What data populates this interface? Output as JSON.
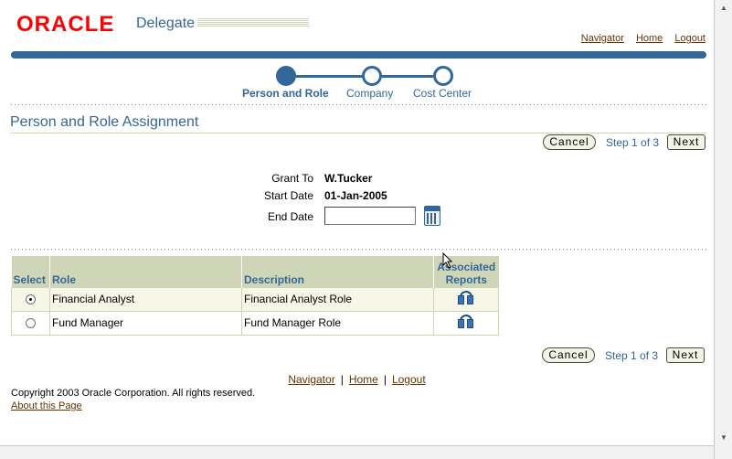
{
  "header": {
    "brand": "ORACLE",
    "app_name": "Delegate",
    "global_links": [
      "Navigator",
      "Home",
      "Logout"
    ]
  },
  "train": {
    "steps": [
      {
        "label": "Person and Role",
        "active": true
      },
      {
        "label": "Company",
        "active": false
      },
      {
        "label": "Cost Center",
        "active": false
      }
    ]
  },
  "page_title": "Person and Role Assignment",
  "nav": {
    "cancel_label": "Cancel",
    "step_text": "Step 1 of 3",
    "next_label": "Next"
  },
  "form": {
    "grant_to_label": "Grant To",
    "grant_to_value": "W.Tucker",
    "start_date_label": "Start Date",
    "start_date_value": "01-Jan-2005",
    "end_date_label": "End Date",
    "end_date_value": ""
  },
  "table": {
    "headers": {
      "select": "Select",
      "role": "Role",
      "description": "Description",
      "reports": "Associated Reports"
    },
    "rows": [
      {
        "role": "Financial Analyst",
        "description": "Financial Analyst Role",
        "selected": true
      },
      {
        "role": "Fund Manager",
        "description": "Fund Manager Role",
        "selected": false
      }
    ]
  },
  "footer": {
    "links": [
      "Navigator",
      "Home",
      "Logout"
    ],
    "separator": "|",
    "copyright": "Copyright 2003 Oracle Corporation. All rights reserved.",
    "about": "About this Page"
  },
  "colors": {
    "brand_red": "#ff0000",
    "accent_blue": "#336699",
    "link_brown": "#663300",
    "table_header_bg": "#cfd6b7"
  }
}
